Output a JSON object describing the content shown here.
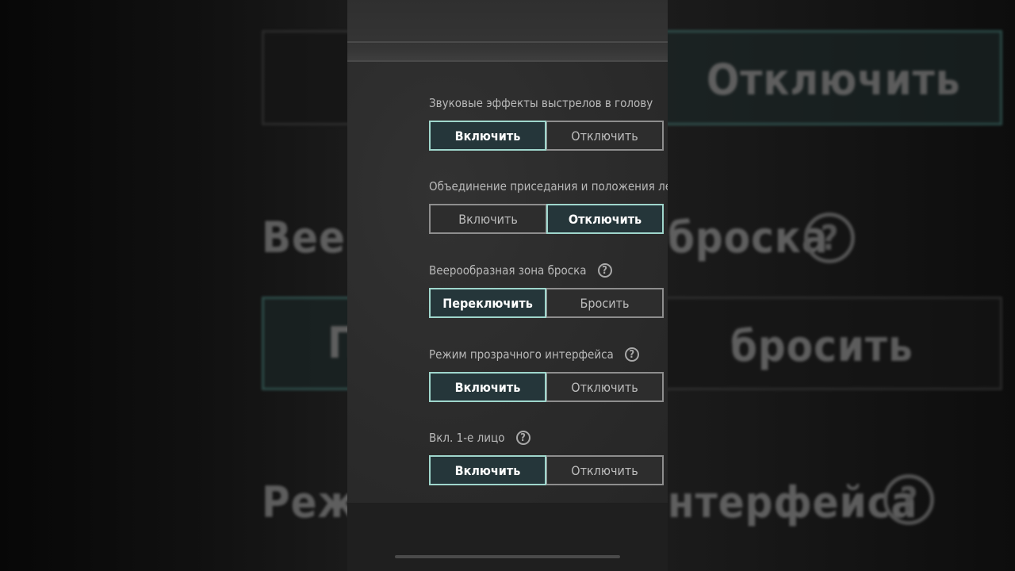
{
  "background": {
    "left_visible": [
      "Вееро",
      "П",
      "Режи"
    ],
    "right_visible": [
      "Отключить",
      "броска",
      "бросить",
      "нтерфейса"
    ],
    "help_glyph": "?"
  },
  "settings": [
    {
      "label": "Звуковые эффекты выстрелов в голову",
      "has_help": false,
      "options": [
        "Включить",
        "Отключить"
      ],
      "selected": 0
    },
    {
      "label": "Объединение приседания и положения ле",
      "has_help": false,
      "options": [
        "Включить",
        "Отключить"
      ],
      "selected": 1
    },
    {
      "label": "Веерообразная зона броска",
      "has_help": true,
      "options": [
        "Переключить",
        "Бросить"
      ],
      "selected": 0
    },
    {
      "label": "Режим прозрачного интерфейса",
      "has_help": true,
      "options": [
        "Включить",
        "Отключить"
      ],
      "selected": 0
    },
    {
      "label": "Вкл. 1-е лицо",
      "has_help": true,
      "options": [
        "Включить",
        "Отключить"
      ],
      "selected": 0
    }
  ],
  "colors": {
    "selected_border": "#9fd6cc",
    "selected_fill": "#25363a",
    "unselected_border": "#8e8e8e",
    "panel_bg": "#2a2a2a"
  },
  "icons": {
    "help": "question-circle-icon",
    "home_indicator": "home-indicator"
  }
}
